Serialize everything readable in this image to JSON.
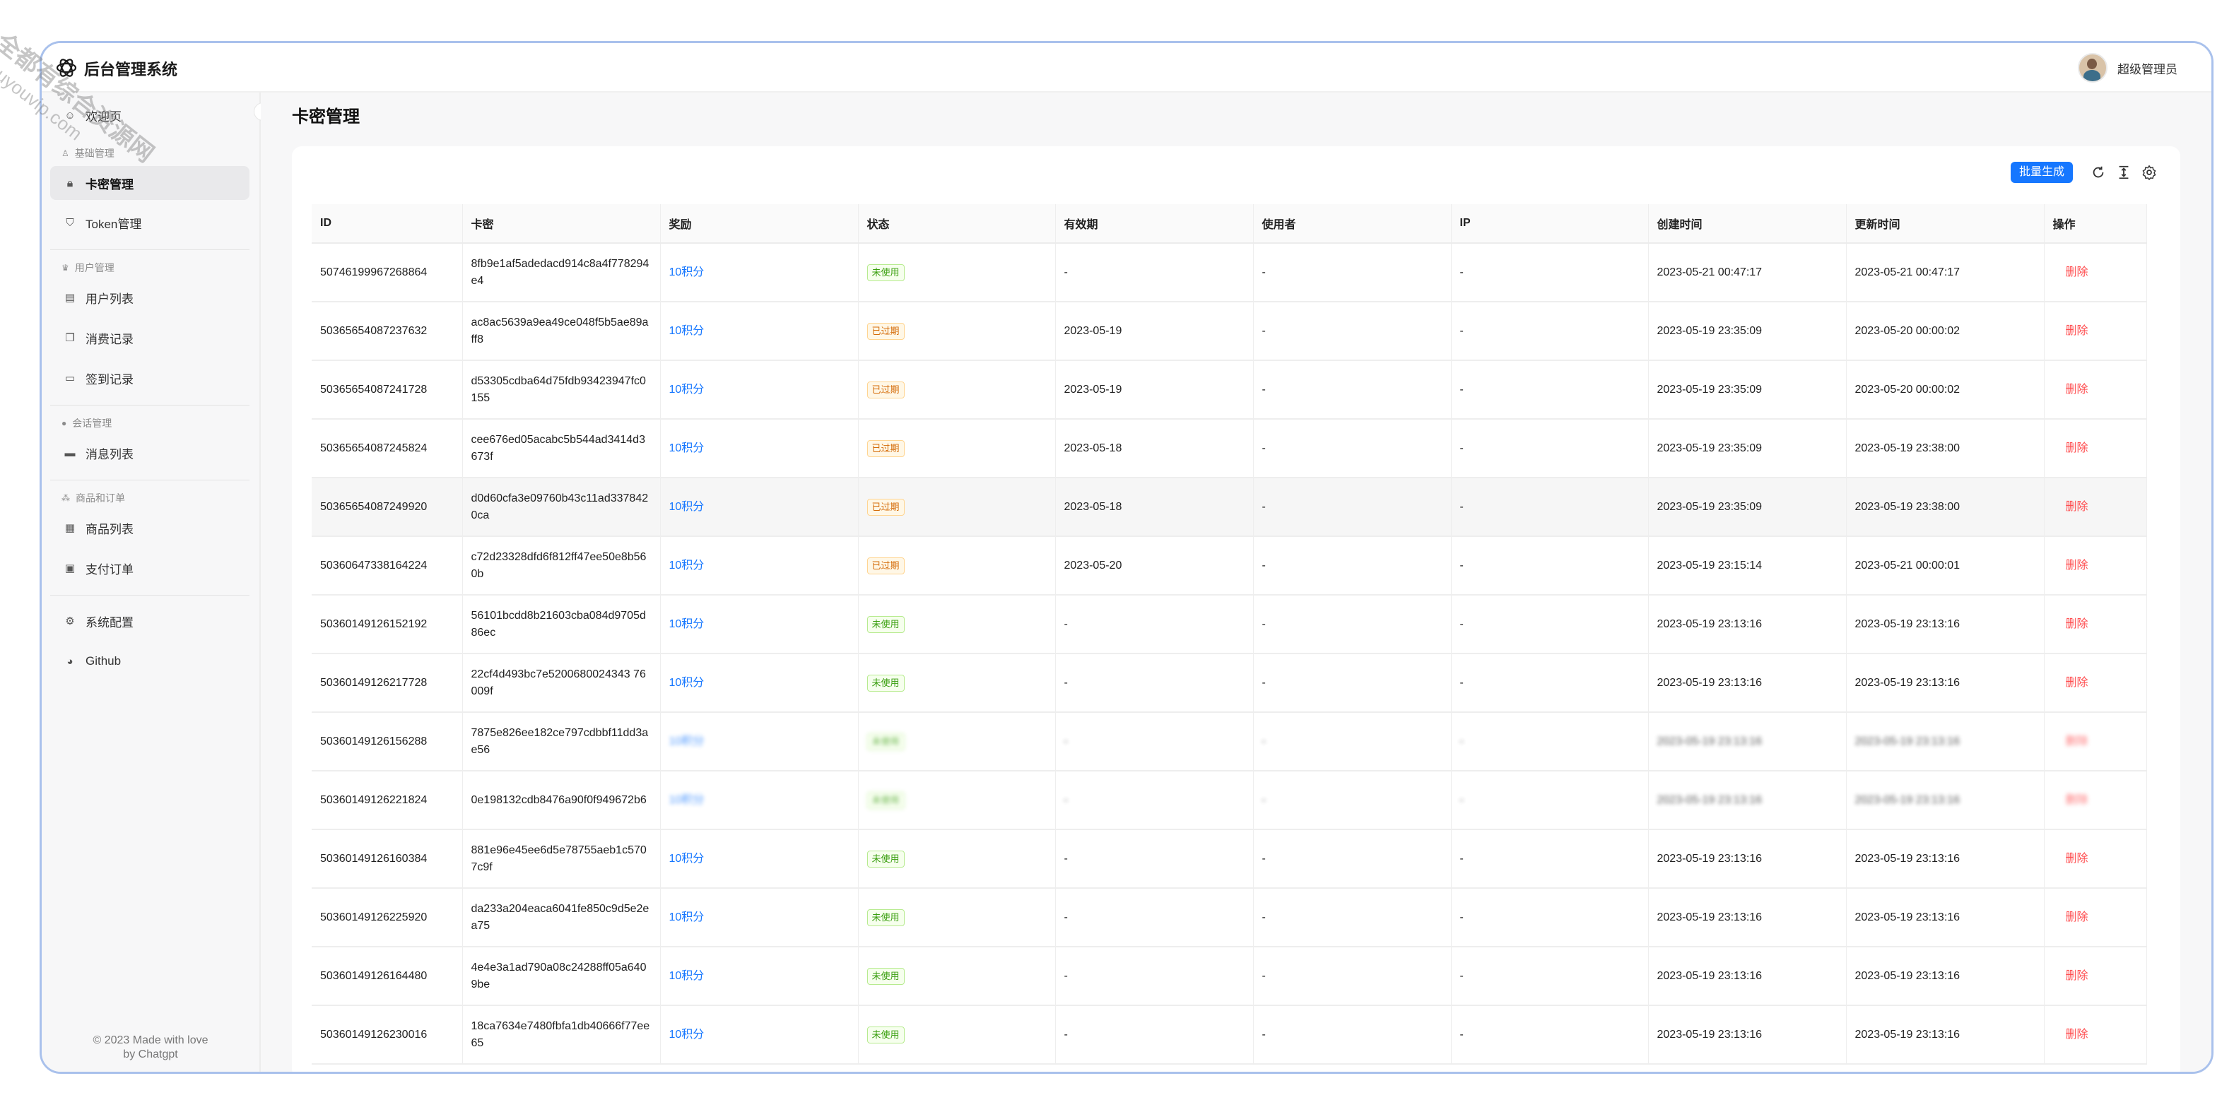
{
  "app": {
    "title": "后台管理系统",
    "user": "超级管理员"
  },
  "sidebar": {
    "top_item": "欢迎页",
    "groups": [
      {
        "label": "基础管理",
        "items": [
          "卡密管理",
          "Token管理"
        ]
      },
      {
        "label": "用户管理",
        "items": [
          "用户列表",
          "消费记录",
          "签到记录"
        ]
      },
      {
        "label": "会话管理",
        "items": [
          "消息列表"
        ]
      },
      {
        "label": "商品和订单",
        "items": [
          "商品列表",
          "支付订单"
        ]
      }
    ],
    "bottom_items": [
      "系统配置",
      "Github"
    ],
    "active": "卡密管理",
    "footer_line1": "© 2023 Made with love",
    "footer_line2": "by Chatgpt"
  },
  "page": {
    "title": "卡密管理",
    "batch_button": "批量生成"
  },
  "table": {
    "columns": [
      "ID",
      "卡密",
      "奖励",
      "状态",
      "有效期",
      "使用者",
      "IP",
      "创建时间",
      "更新时间",
      "操作"
    ],
    "rows": [
      [
        "50746199967268864",
        "8fb9e1af5adedacd914c8a4f778294e4",
        "10积分",
        "未使用",
        "-",
        "-",
        "-",
        "2023-05-21 00:47:17",
        "2023-05-21 00:47:17",
        "删除"
      ],
      [
        "50365654087237632",
        "ac8ac5639a9ea49ce048f5b5ae89aff8",
        "10积分",
        "已过期",
        "2023-05-19",
        "-",
        "-",
        "2023-05-19 23:35:09",
        "2023-05-20 00:00:02",
        "删除"
      ],
      [
        "50365654087241728",
        "d53305cdba64d75fdb93423947fc0155",
        "10积分",
        "已过期",
        "2023-05-19",
        "-",
        "-",
        "2023-05-19 23:35:09",
        "2023-05-20 00:00:02",
        "删除"
      ],
      [
        "50365654087245824",
        "cee676ed05acabc5b544ad3414d3673f",
        "10积分",
        "已过期",
        "2023-05-18",
        "-",
        "-",
        "2023-05-19 23:35:09",
        "2023-05-19 23:38:00",
        "删除"
      ],
      [
        "50365654087249920",
        "d0d60cfa3e09760b43c11ad3378420ca",
        "10积分",
        "已过期",
        "2023-05-18",
        "-",
        "-",
        "2023-05-19 23:35:09",
        "2023-05-19 23:38:00",
        "删除"
      ],
      [
        "50360647338164224",
        "c72d23328dfd6f812ff47ee50e8b560b",
        "10积分",
        "已过期",
        "2023-05-20",
        "-",
        "-",
        "2023-05-19 23:15:14",
        "2023-05-21 00:00:01",
        "删除"
      ],
      [
        "50360149126152192",
        "56101bcdd8b21603cba084d9705d86ec",
        "10积分",
        "未使用",
        "-",
        "-",
        "-",
        "2023-05-19 23:13:16",
        "2023-05-19 23:13:16",
        "删除"
      ],
      [
        "50360149126217728",
        "22cf4d493bc7e5200680024343 76009f",
        "10积分",
        "未使用",
        "-",
        "-",
        "-",
        "2023-05-19 23:13:16",
        "2023-05-19 23:13:16",
        "删除"
      ],
      [
        "50360149126156288",
        "7875e826ee182ce797cdbbf11dd3ae56",
        "10积分",
        "未使用",
        "-",
        "-",
        "-",
        "2023-05-19 23:13:16",
        "2023-05-19 23:13:16",
        "删除"
      ],
      [
        "50360149126221824",
        "0e198132cdb8476a90f0f949672b6",
        "10积分",
        "未使用",
        "-",
        "-",
        "-",
        "2023-05-19 23:13:16",
        "2023-05-19 23:13:16",
        "删除"
      ],
      [
        "50360149126160384",
        "881e96e45ee6d5e78755aeb1c5707c9f",
        "10积分",
        "未使用",
        "-",
        "-",
        "-",
        "2023-05-19 23:13:16",
        "2023-05-19 23:13:16",
        "删除"
      ],
      [
        "50360149126225920",
        "da233a204eaca6041fe850c9d5e2ea75",
        "10积分",
        "未使用",
        "-",
        "-",
        "-",
        "2023-05-19 23:13:16",
        "2023-05-19 23:13:16",
        "删除"
      ],
      [
        "50360149126164480",
        "4e4e3a1ad790a08c24288ff05a6409be",
        "10积分",
        "未使用",
        "-",
        "-",
        "-",
        "2023-05-19 23:13:16",
        "2023-05-19 23:13:16",
        "删除"
      ],
      [
        "50360149126230016",
        "18ca7634e7480fbfa1db40666f77ee65",
        "10积分",
        "未使用",
        "-",
        "-",
        "-",
        "2023-05-19 23:13:16",
        "2023-05-19 23:13:16",
        "删除"
      ]
    ]
  },
  "watermark": {
    "line1": "全都有综合资源网",
    "line2": "douyouvip.com"
  },
  "colors": {
    "primary": "#1677ff",
    "danger": "#ff4d4f",
    "success": "#389e0d",
    "warning": "#d46b08",
    "frame": "#a9c1ec"
  }
}
